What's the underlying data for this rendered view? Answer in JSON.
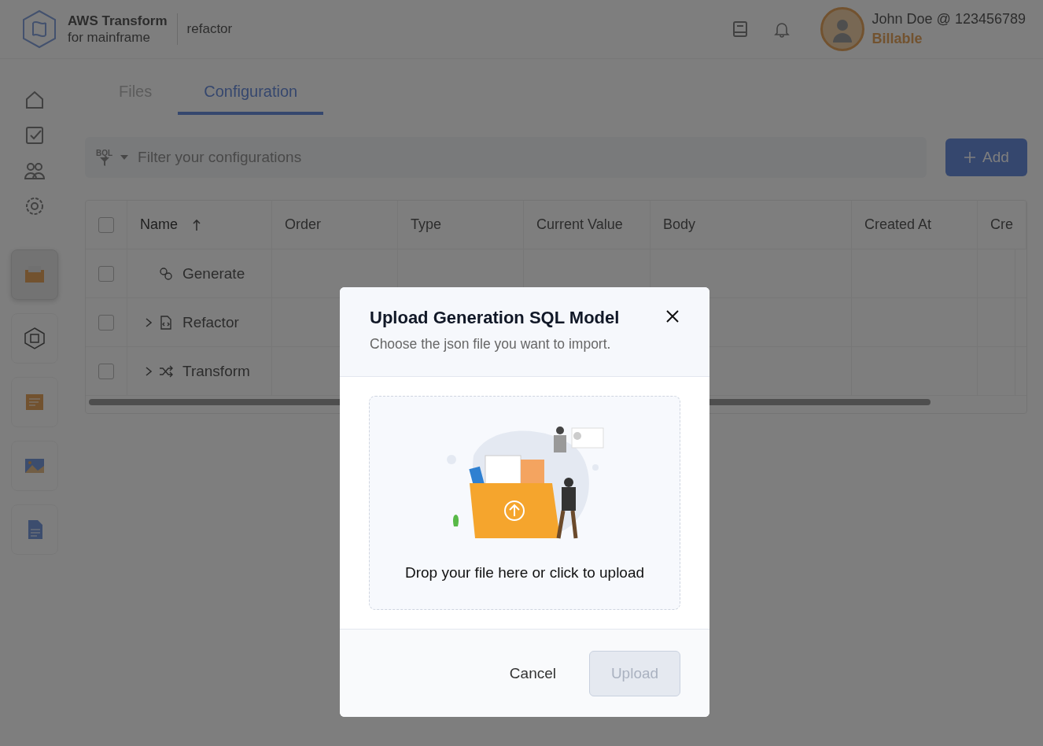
{
  "header": {
    "product_name": "AWS Transform",
    "product_subtitle": "for mainframe",
    "project": "refactor",
    "user": {
      "name": "John Doe @ 123456789",
      "plan": "Billable"
    }
  },
  "sidebar": {
    "nav": [
      {
        "kind": "home"
      },
      {
        "kind": "tasks"
      },
      {
        "kind": "people"
      },
      {
        "kind": "settings"
      }
    ],
    "apps": [
      {
        "kind": "folder",
        "selected": true
      },
      {
        "kind": "chip",
        "selected": false
      },
      {
        "kind": "notes",
        "selected": false
      },
      {
        "kind": "images",
        "selected": false
      },
      {
        "kind": "document",
        "selected": false
      }
    ]
  },
  "tabs": [
    {
      "label": "Files",
      "selected": false
    },
    {
      "label": "Configuration",
      "selected": true
    }
  ],
  "filter": {
    "badge": "BQL",
    "placeholder": "Filter your configurations"
  },
  "add_button": {
    "label": "Add"
  },
  "table": {
    "select_all_checked": false,
    "columns": [
      {
        "label": "Name",
        "sorted": true
      },
      {
        "label": "Order",
        "sorted": false
      },
      {
        "label": "Type",
        "sorted": false
      },
      {
        "label": "Current Value",
        "sorted": false
      },
      {
        "label": "Body",
        "sorted": false
      },
      {
        "label": "Created At",
        "sorted": false
      },
      {
        "label": "Cre",
        "sorted": false
      }
    ],
    "rows": [
      {
        "name": "Generate",
        "kind": "gears",
        "has_children": false,
        "checked": false
      },
      {
        "name": "Refactor",
        "kind": "code-file",
        "has_children": true,
        "checked": false
      },
      {
        "name": "Transform",
        "kind": "shuffle",
        "has_children": true,
        "checked": false
      }
    ]
  },
  "modal": {
    "title": "Upload Generation SQL Model",
    "subtitle": "Choose the json file you want to import.",
    "dropzone_text": "Drop your file here or click to upload",
    "cancel": "Cancel",
    "upload": {
      "label": "Upload",
      "disabled": true
    }
  }
}
